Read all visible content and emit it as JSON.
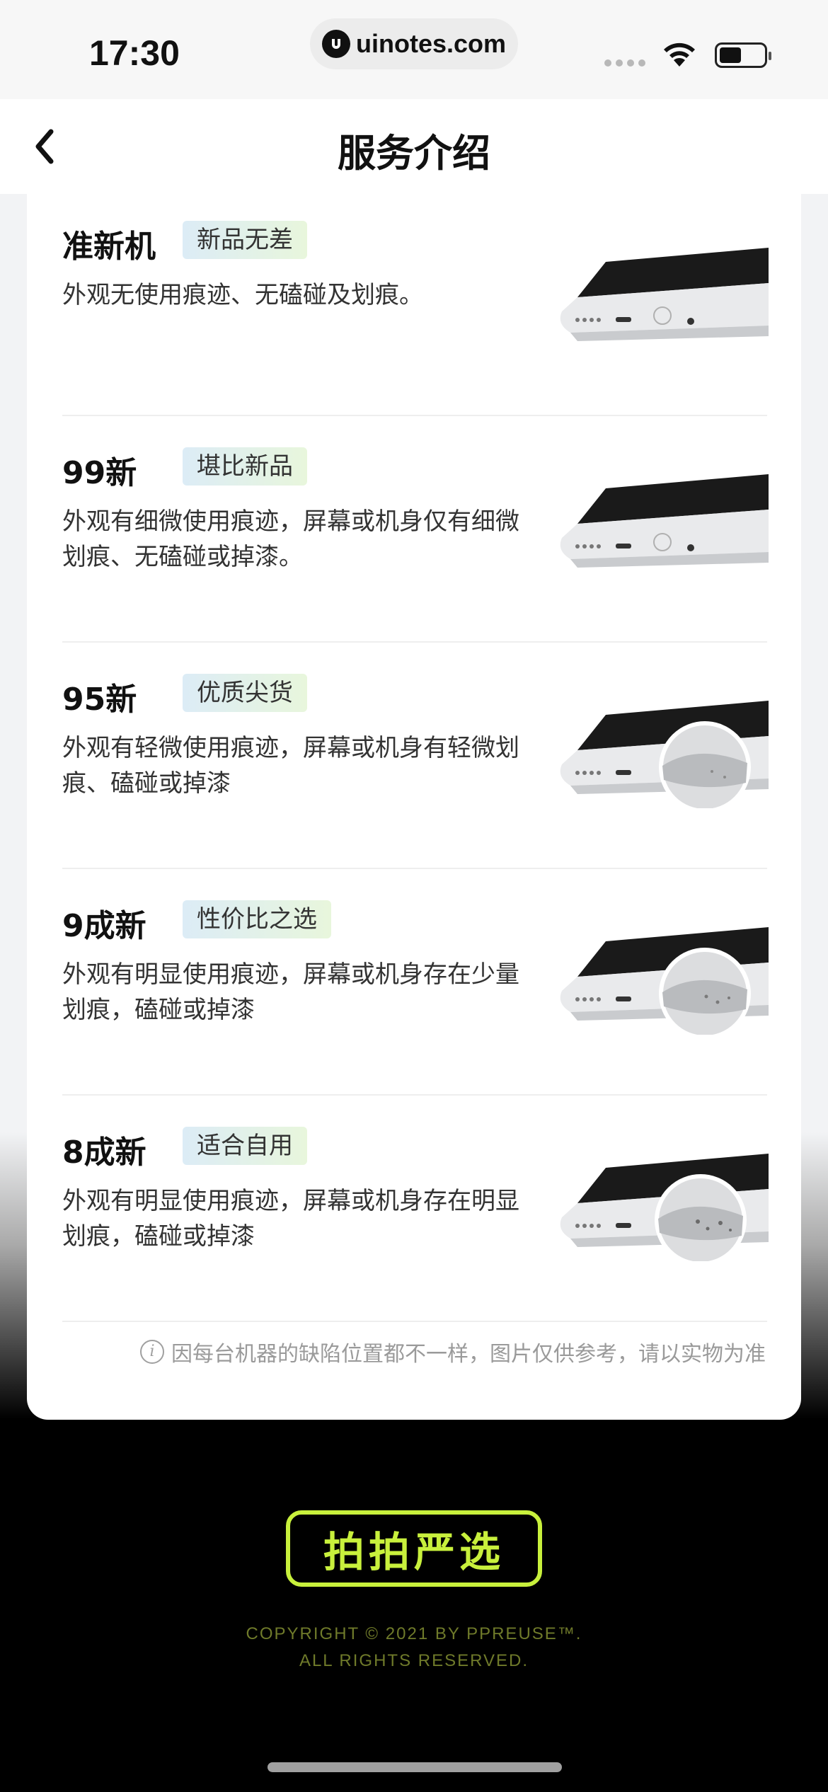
{
  "status_bar": {
    "time": "17:30",
    "url": "uinotes.com",
    "icons": [
      "signal-icon",
      "wifi-icon",
      "battery-icon"
    ]
  },
  "nav": {
    "title": "服务介绍",
    "back_icon": "chevron-left-icon"
  },
  "items": [
    {
      "title": "准新机",
      "badge": "新品无差",
      "desc": "外观无使用痕迹、无磕碰及划痕。",
      "has_zoom": false
    },
    {
      "title": "99新",
      "badge": "堪比新品",
      "desc": "外观有细微使用痕迹，屏幕或机身仅有细微划痕、无磕碰或掉漆。",
      "has_zoom": false
    },
    {
      "title": "95新",
      "badge": "优质尖货",
      "desc": "外观有轻微使用痕迹，屏幕或机身有轻微划痕、磕碰或掉漆",
      "has_zoom": true
    },
    {
      "title": "9成新",
      "badge": "性价比之选",
      "desc": "外观有明显使用痕迹，屏幕或机身存在少量划痕，磕碰或掉漆",
      "has_zoom": true
    },
    {
      "title": "8成新",
      "badge": "适合自用",
      "desc": "外观有明显使用痕迹，屏幕或机身存在明显划痕，磕碰或掉漆",
      "has_zoom": true
    }
  ],
  "footnote": "因每台机器的缺陷位置都不一样，图片仅供参考，请以实物为准",
  "footer": {
    "brand": "拍拍严选",
    "copyright_line1": "COPYRIGHT © 2021 BY PPREUSE™.",
    "copyright_line2": "ALL RIGHTS RESERVED."
  },
  "colors": {
    "brand_green": "#c8f03c",
    "badge_gradient": [
      "#dcecf6",
      "#e8f6dc"
    ]
  }
}
